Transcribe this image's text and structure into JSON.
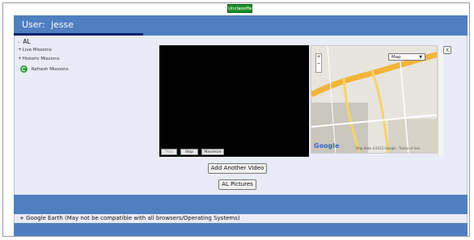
{
  "banner": {
    "classification": "Unclassified"
  },
  "header": {
    "user_label": "User:",
    "user_name": "jesse"
  },
  "tree": {
    "root_label": "AL",
    "items": [
      {
        "label": "Live Missions"
      },
      {
        "label": "Historic Missions"
      }
    ],
    "refresh_label": "Refresh Missions"
  },
  "video_controls": {
    "play": "Play",
    "stop": "Stop",
    "maximize": "Maximize"
  },
  "map": {
    "type_select": "Map",
    "brand": "Google",
    "attribution": "Map data ©2015 Google · Terms of Use"
  },
  "buttons": {
    "add_video": "Add Another Video",
    "pictures": "AL Pictures"
  },
  "google_earth": {
    "label": "Google Earth (May not be compatible with all browsers/Operating Systems)"
  },
  "colors": {
    "header_blue": "#4f7fc1",
    "accent_navy": "#0b1f6e",
    "banner_green": "#1f8f2a",
    "panel_bg": "#e9ecf6"
  }
}
